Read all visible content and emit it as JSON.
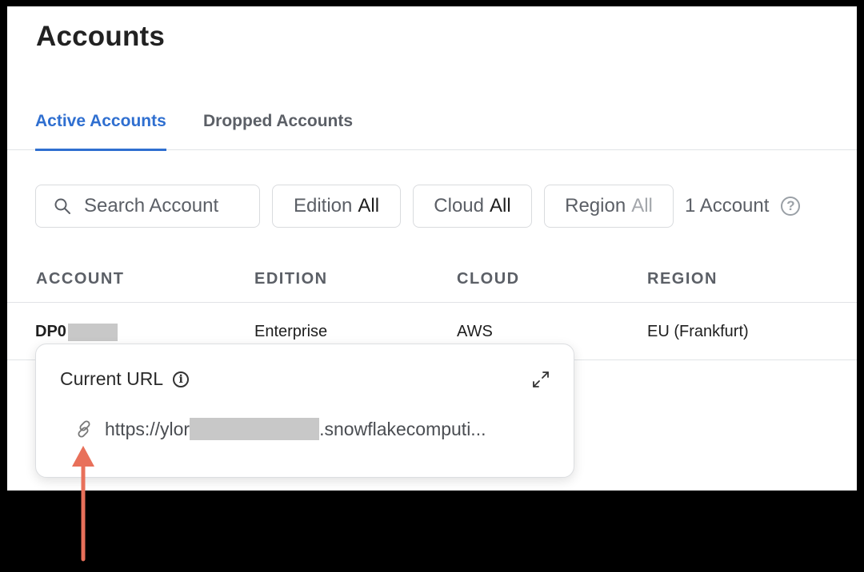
{
  "page": {
    "title": "Accounts"
  },
  "tabs": [
    {
      "label": "Active Accounts",
      "active": true
    },
    {
      "label": "Dropped Accounts",
      "active": false
    }
  ],
  "search": {
    "placeholder": "Search Account"
  },
  "filters": {
    "edition": {
      "label": "Edition",
      "value": "All"
    },
    "cloud": {
      "label": "Cloud",
      "value": "All"
    },
    "region": {
      "label": "Region",
      "value": "All"
    }
  },
  "count": "1 Account",
  "table": {
    "headers": [
      "ACCOUNT",
      "EDITION",
      "CLOUD",
      "REGION"
    ],
    "rows": [
      {
        "account": "DP0",
        "edition": "Enterprise",
        "cloud": "AWS",
        "region": "EU (Frankfurt)"
      }
    ]
  },
  "popover": {
    "title": "Current URL",
    "url_prefix": "https://ylor",
    "url_suffix": ".snowflakecomputi..."
  },
  "icons": [
    "search-icon",
    "help-icon",
    "info-icon",
    "expand-icon",
    "link-icon",
    "arrow-up-annotation"
  ],
  "colors": {
    "accent": "#2f6fd0",
    "annotation_arrow": "#e8705a",
    "frame": "#000000"
  }
}
